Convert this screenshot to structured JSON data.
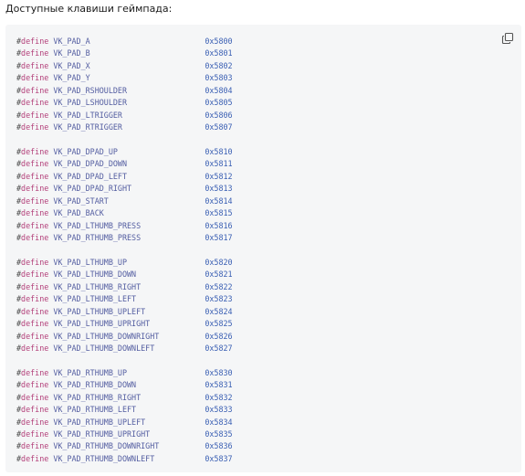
{
  "intro_text": "Доступные клавиши геймпада:",
  "copy_icon": "copy-icon",
  "keyword": "define",
  "hash": "#",
  "groups": [
    [
      {
        "name": "VK_PAD_A",
        "value": "0x5800"
      },
      {
        "name": "VK_PAD_B",
        "value": "0x5801"
      },
      {
        "name": "VK_PAD_X",
        "value": "0x5802"
      },
      {
        "name": "VK_PAD_Y",
        "value": "0x5803"
      },
      {
        "name": "VK_PAD_RSHOULDER",
        "value": "0x5804"
      },
      {
        "name": "VK_PAD_LSHOULDER",
        "value": "0x5805"
      },
      {
        "name": "VK_PAD_LTRIGGER",
        "value": "0x5806"
      },
      {
        "name": "VK_PAD_RTRIGGER",
        "value": "0x5807"
      }
    ],
    [
      {
        "name": "VK_PAD_DPAD_UP",
        "value": "0x5810"
      },
      {
        "name": "VK_PAD_DPAD_DOWN",
        "value": "0x5811"
      },
      {
        "name": "VK_PAD_DPAD_LEFT",
        "value": "0x5812"
      },
      {
        "name": "VK_PAD_DPAD_RIGHT",
        "value": "0x5813"
      },
      {
        "name": "VK_PAD_START",
        "value": "0x5814"
      },
      {
        "name": "VK_PAD_BACK",
        "value": "0x5815"
      },
      {
        "name": "VK_PAD_LTHUMB_PRESS",
        "value": "0x5816"
      },
      {
        "name": "VK_PAD_RTHUMB_PRESS",
        "value": "0x5817"
      }
    ],
    [
      {
        "name": "VK_PAD_LTHUMB_UP",
        "value": "0x5820"
      },
      {
        "name": "VK_PAD_LTHUMB_DOWN",
        "value": "0x5821"
      },
      {
        "name": "VK_PAD_LTHUMB_RIGHT",
        "value": "0x5822"
      },
      {
        "name": "VK_PAD_LTHUMB_LEFT",
        "value": "0x5823"
      },
      {
        "name": "VK_PAD_LTHUMB_UPLEFT",
        "value": "0x5824"
      },
      {
        "name": "VK_PAD_LTHUMB_UPRIGHT",
        "value": "0x5825"
      },
      {
        "name": "VK_PAD_LTHUMB_DOWNRIGHT",
        "value": "0x5826"
      },
      {
        "name": "VK_PAD_LTHUMB_DOWNLEFT",
        "value": "0x5827"
      }
    ],
    [
      {
        "name": "VK_PAD_RTHUMB_UP",
        "value": "0x5830"
      },
      {
        "name": "VK_PAD_RTHUMB_DOWN",
        "value": "0x5831"
      },
      {
        "name": "VK_PAD_RTHUMB_RIGHT",
        "value": "0x5832"
      },
      {
        "name": "VK_PAD_RTHUMB_LEFT",
        "value": "0x5833"
      },
      {
        "name": "VK_PAD_RTHUMB_UPLEFT",
        "value": "0x5834"
      },
      {
        "name": "VK_PAD_RTHUMB_UPRIGHT",
        "value": "0x5835"
      },
      {
        "name": "VK_PAD_RTHUMB_DOWNRIGHT",
        "value": "0x5836"
      },
      {
        "name": "VK_PAD_RTHUMB_DOWNLEFT",
        "value": "0x5837"
      }
    ]
  ]
}
